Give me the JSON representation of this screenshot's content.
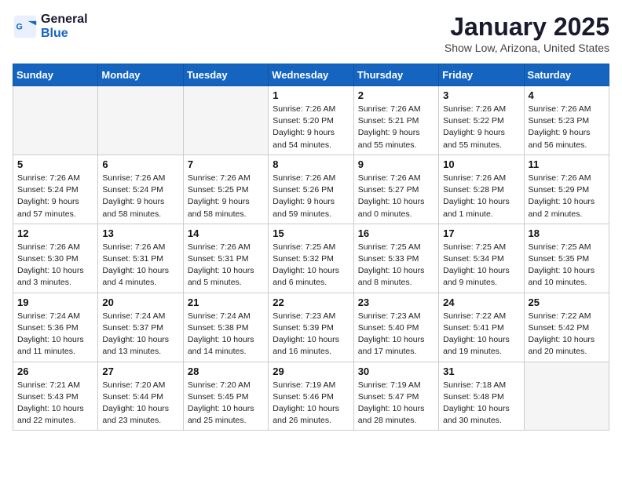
{
  "header": {
    "logo_line1": "General",
    "logo_line2": "Blue",
    "month_title": "January 2025",
    "location": "Show Low, Arizona, United States"
  },
  "days_of_week": [
    "Sunday",
    "Monday",
    "Tuesday",
    "Wednesday",
    "Thursday",
    "Friday",
    "Saturday"
  ],
  "weeks": [
    [
      {
        "day": "",
        "info": ""
      },
      {
        "day": "",
        "info": ""
      },
      {
        "day": "",
        "info": ""
      },
      {
        "day": "1",
        "info": "Sunrise: 7:26 AM\nSunset: 5:20 PM\nDaylight: 9 hours\nand 54 minutes."
      },
      {
        "day": "2",
        "info": "Sunrise: 7:26 AM\nSunset: 5:21 PM\nDaylight: 9 hours\nand 55 minutes."
      },
      {
        "day": "3",
        "info": "Sunrise: 7:26 AM\nSunset: 5:22 PM\nDaylight: 9 hours\nand 55 minutes."
      },
      {
        "day": "4",
        "info": "Sunrise: 7:26 AM\nSunset: 5:23 PM\nDaylight: 9 hours\nand 56 minutes."
      }
    ],
    [
      {
        "day": "5",
        "info": "Sunrise: 7:26 AM\nSunset: 5:24 PM\nDaylight: 9 hours\nand 57 minutes."
      },
      {
        "day": "6",
        "info": "Sunrise: 7:26 AM\nSunset: 5:24 PM\nDaylight: 9 hours\nand 58 minutes."
      },
      {
        "day": "7",
        "info": "Sunrise: 7:26 AM\nSunset: 5:25 PM\nDaylight: 9 hours\nand 58 minutes."
      },
      {
        "day": "8",
        "info": "Sunrise: 7:26 AM\nSunset: 5:26 PM\nDaylight: 9 hours\nand 59 minutes."
      },
      {
        "day": "9",
        "info": "Sunrise: 7:26 AM\nSunset: 5:27 PM\nDaylight: 10 hours\nand 0 minutes."
      },
      {
        "day": "10",
        "info": "Sunrise: 7:26 AM\nSunset: 5:28 PM\nDaylight: 10 hours\nand 1 minute."
      },
      {
        "day": "11",
        "info": "Sunrise: 7:26 AM\nSunset: 5:29 PM\nDaylight: 10 hours\nand 2 minutes."
      }
    ],
    [
      {
        "day": "12",
        "info": "Sunrise: 7:26 AM\nSunset: 5:30 PM\nDaylight: 10 hours\nand 3 minutes."
      },
      {
        "day": "13",
        "info": "Sunrise: 7:26 AM\nSunset: 5:31 PM\nDaylight: 10 hours\nand 4 minutes."
      },
      {
        "day": "14",
        "info": "Sunrise: 7:26 AM\nSunset: 5:31 PM\nDaylight: 10 hours\nand 5 minutes."
      },
      {
        "day": "15",
        "info": "Sunrise: 7:25 AM\nSunset: 5:32 PM\nDaylight: 10 hours\nand 6 minutes."
      },
      {
        "day": "16",
        "info": "Sunrise: 7:25 AM\nSunset: 5:33 PM\nDaylight: 10 hours\nand 8 minutes."
      },
      {
        "day": "17",
        "info": "Sunrise: 7:25 AM\nSunset: 5:34 PM\nDaylight: 10 hours\nand 9 minutes."
      },
      {
        "day": "18",
        "info": "Sunrise: 7:25 AM\nSunset: 5:35 PM\nDaylight: 10 hours\nand 10 minutes."
      }
    ],
    [
      {
        "day": "19",
        "info": "Sunrise: 7:24 AM\nSunset: 5:36 PM\nDaylight: 10 hours\nand 11 minutes."
      },
      {
        "day": "20",
        "info": "Sunrise: 7:24 AM\nSunset: 5:37 PM\nDaylight: 10 hours\nand 13 minutes."
      },
      {
        "day": "21",
        "info": "Sunrise: 7:24 AM\nSunset: 5:38 PM\nDaylight: 10 hours\nand 14 minutes."
      },
      {
        "day": "22",
        "info": "Sunrise: 7:23 AM\nSunset: 5:39 PM\nDaylight: 10 hours\nand 16 minutes."
      },
      {
        "day": "23",
        "info": "Sunrise: 7:23 AM\nSunset: 5:40 PM\nDaylight: 10 hours\nand 17 minutes."
      },
      {
        "day": "24",
        "info": "Sunrise: 7:22 AM\nSunset: 5:41 PM\nDaylight: 10 hours\nand 19 minutes."
      },
      {
        "day": "25",
        "info": "Sunrise: 7:22 AM\nSunset: 5:42 PM\nDaylight: 10 hours\nand 20 minutes."
      }
    ],
    [
      {
        "day": "26",
        "info": "Sunrise: 7:21 AM\nSunset: 5:43 PM\nDaylight: 10 hours\nand 22 minutes."
      },
      {
        "day": "27",
        "info": "Sunrise: 7:20 AM\nSunset: 5:44 PM\nDaylight: 10 hours\nand 23 minutes."
      },
      {
        "day": "28",
        "info": "Sunrise: 7:20 AM\nSunset: 5:45 PM\nDaylight: 10 hours\nand 25 minutes."
      },
      {
        "day": "29",
        "info": "Sunrise: 7:19 AM\nSunset: 5:46 PM\nDaylight: 10 hours\nand 26 minutes."
      },
      {
        "day": "30",
        "info": "Sunrise: 7:19 AM\nSunset: 5:47 PM\nDaylight: 10 hours\nand 28 minutes."
      },
      {
        "day": "31",
        "info": "Sunrise: 7:18 AM\nSunset: 5:48 PM\nDaylight: 10 hours\nand 30 minutes."
      },
      {
        "day": "",
        "info": ""
      }
    ]
  ]
}
